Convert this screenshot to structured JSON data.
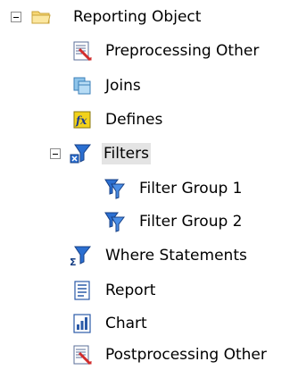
{
  "tree": {
    "root": {
      "label": "Reporting Object",
      "icon": "folder-icon",
      "expanded": true
    },
    "children": [
      {
        "label": "Preprocessing Other",
        "icon": "preprocessing-icon"
      },
      {
        "label": "Joins",
        "icon": "joins-icon"
      },
      {
        "label": "Defines",
        "icon": "defines-fx-icon"
      },
      {
        "label": "Filters",
        "icon": "filter-icon",
        "expanded": true,
        "selected": true,
        "children": [
          {
            "label": "Filter Group 1",
            "icon": "filter-group-icon"
          },
          {
            "label": "Filter Group 2",
            "icon": "filter-group-icon"
          }
        ]
      },
      {
        "label": "Where Statements",
        "icon": "where-statements-icon"
      },
      {
        "label": "Report",
        "icon": "report-icon"
      },
      {
        "label": "Chart",
        "icon": "chart-icon"
      },
      {
        "label": "Postprocessing Other",
        "icon": "postprocessing-icon"
      }
    ]
  }
}
